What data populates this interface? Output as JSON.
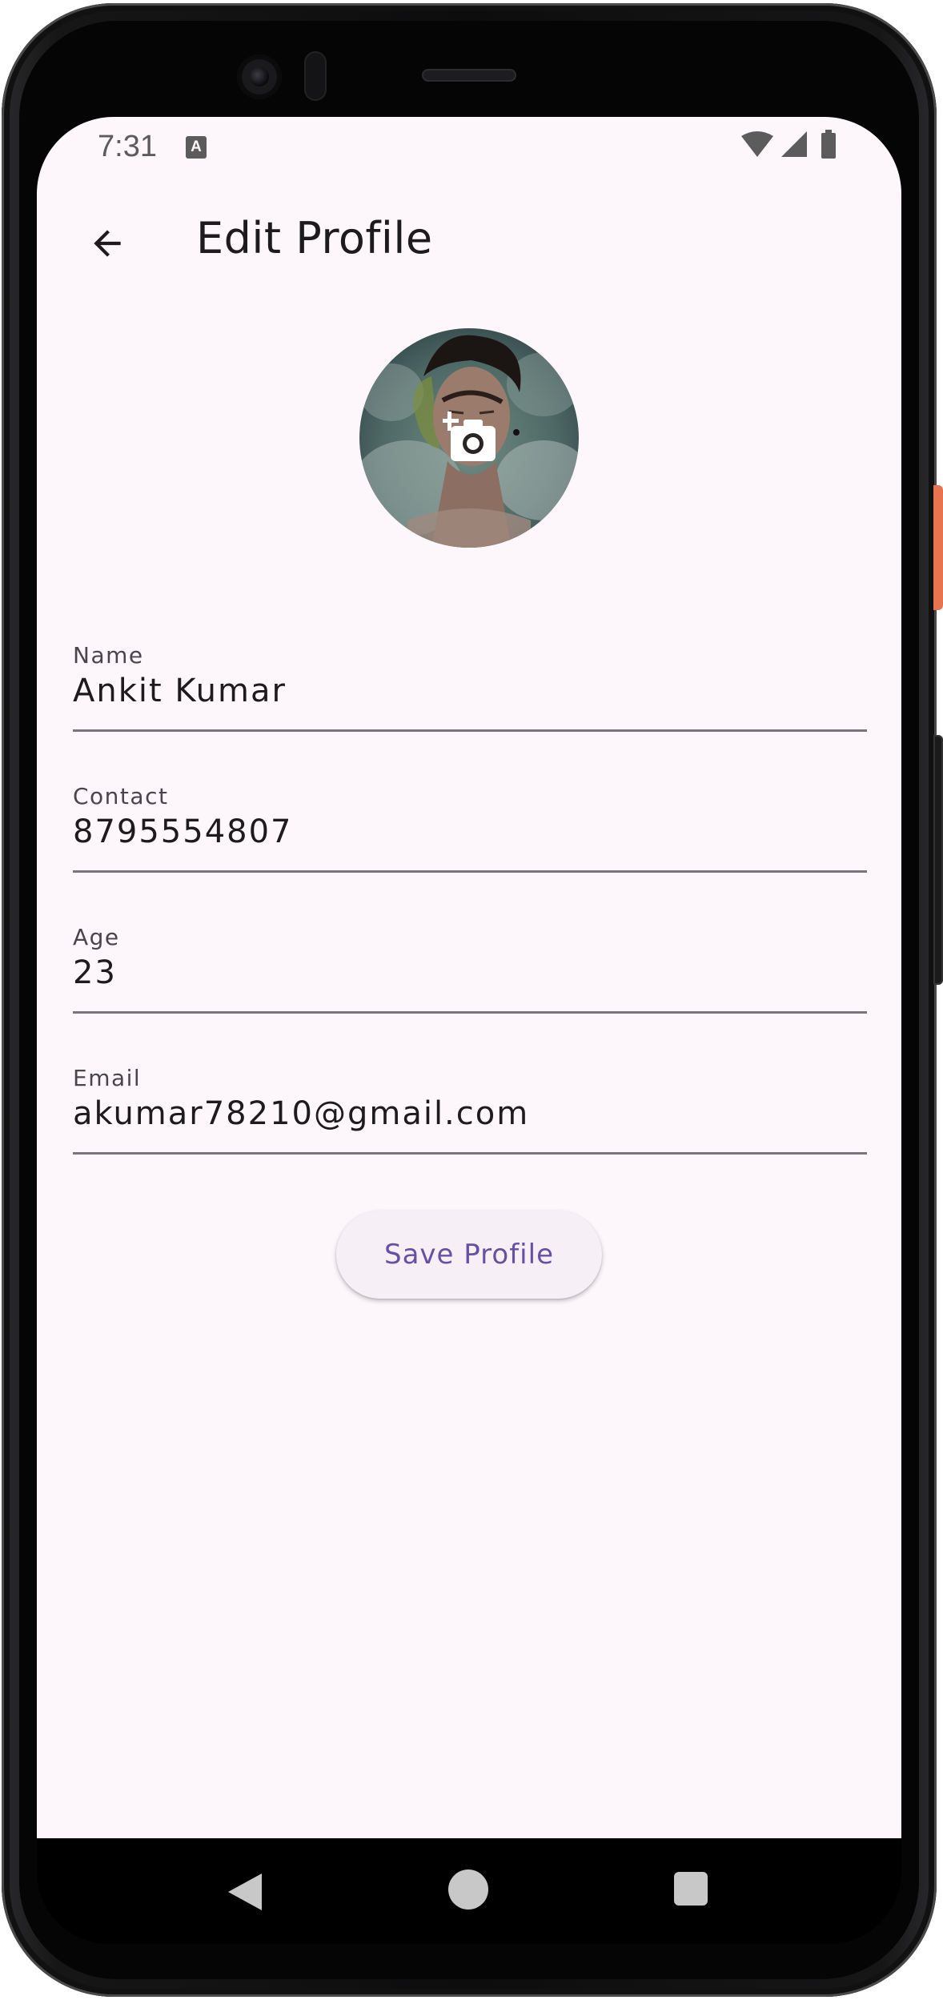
{
  "status_bar": {
    "time": "7:31",
    "notification_icon": "a-icon",
    "notification_glyph": "A",
    "right_icons": [
      "wifi-icon",
      "cellular-signal-icon",
      "battery-icon"
    ]
  },
  "app_bar": {
    "title": "Edit Profile",
    "back_icon": "arrow-back-icon"
  },
  "avatar": {
    "overlay_icon": "add-a-photo-icon"
  },
  "form": {
    "fields": [
      {
        "label": "Name",
        "value": "Ankit Kumar"
      },
      {
        "label": "Contact",
        "value": "8795554807"
      },
      {
        "label": "Age",
        "value": "23"
      },
      {
        "label": "Email",
        "value": "akumar78210@gmail.com"
      }
    ]
  },
  "actions": {
    "save_label": "Save Profile"
  },
  "system_nav": {
    "back_icon": "triangle-back-icon",
    "home_icon": "circle-home-icon",
    "recents_icon": "square-recents-icon"
  },
  "colors": {
    "background": "#fdf7fb",
    "primary": "#6750a4",
    "text": "#1d1b1e",
    "label": "#49454f",
    "divider": "#79747e",
    "button_surface": "#f6eff6"
  }
}
